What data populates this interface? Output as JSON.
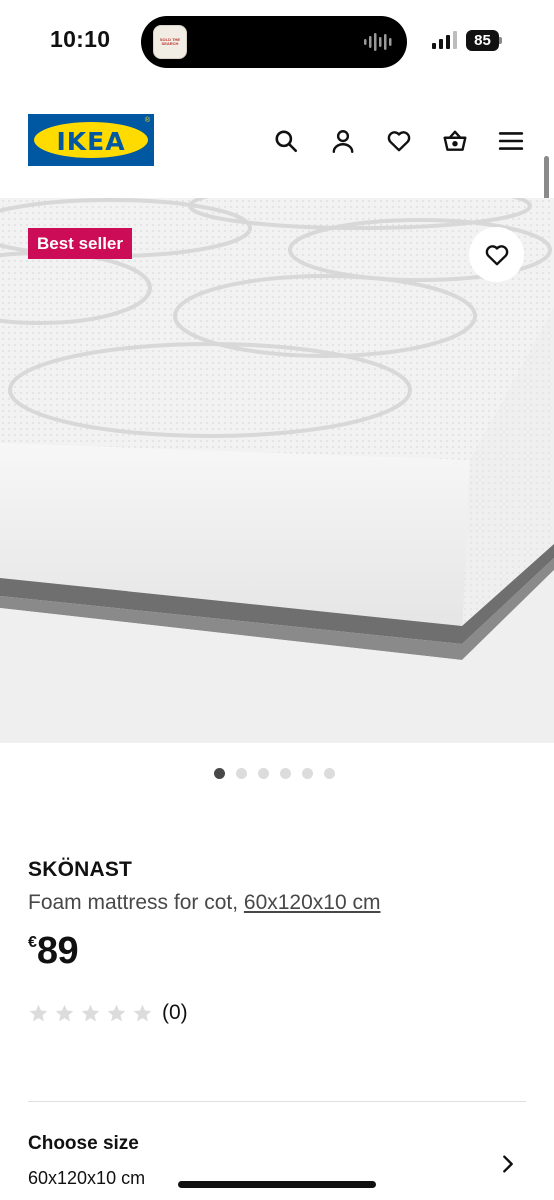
{
  "status_bar": {
    "time": "10:10",
    "battery": "85",
    "island_thumb_text": "SOLD THE SEARCH",
    "icons": [
      "signal-bars-icon",
      "battery-icon",
      "audio-wave-icon"
    ]
  },
  "header": {
    "logo": "IKEA",
    "icons": [
      "search-icon",
      "account-icon",
      "heart-icon",
      "basket-icon",
      "menu-icon"
    ],
    "brand_blue": "#0058a3",
    "brand_yellow": "#ffdb00"
  },
  "product_image": {
    "badge": "Best seller",
    "badge_color": "#cc0c56",
    "favourite_icon": "heart-icon"
  },
  "carousel": {
    "count": 6,
    "active_index": 0
  },
  "product": {
    "name": "SKÖNAST",
    "description": "Foam mattress for cot, ",
    "size_link": "60x120x10 cm",
    "currency": "€",
    "price": "89",
    "rating": 0,
    "rating_max": 5,
    "reviews": "(0)"
  },
  "size_selector": {
    "title": "Choose size",
    "value": "60x120x10 cm",
    "icon": "chevron-right-icon"
  }
}
